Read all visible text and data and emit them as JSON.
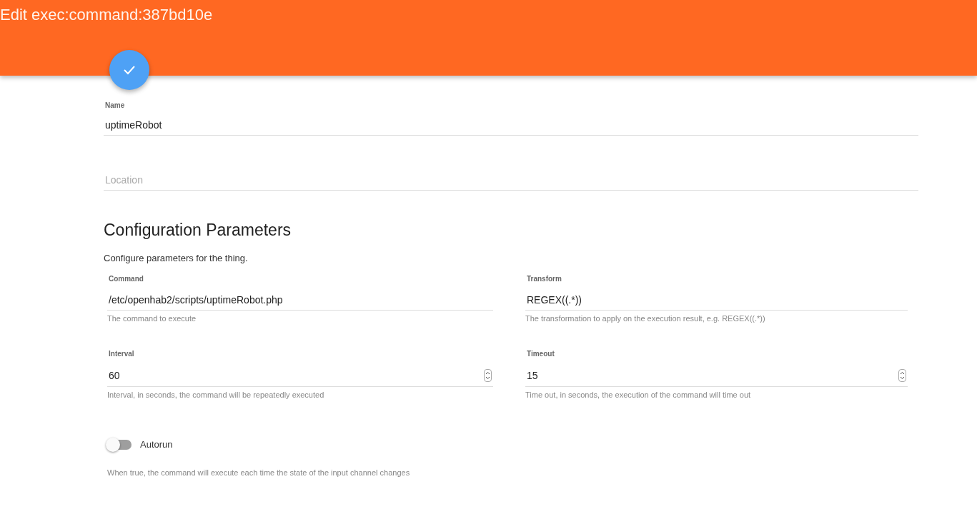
{
  "header": {
    "title": "Edit exec:command:387bd10e"
  },
  "fields": [
    {
      "label": "Name",
      "value": "uptimeRobot"
    },
    {
      "placeholder": "Location"
    }
  ],
  "config": {
    "title": "Configuration Parameters",
    "description": "Configure parameters for the thing.",
    "params": [
      {
        "kind": "text",
        "label": "Command",
        "value": "/etc/openhab2/scripts/uptimeRobot.php",
        "hint": "The command to execute"
      },
      {
        "kind": "text",
        "label": "Transform",
        "value": "REGEX((.*))",
        "hint": "The transformation to apply on the execution result, e.g. REGEX((.*))"
      },
      {
        "kind": "number",
        "label": "Interval",
        "value": "60",
        "hint": "Interval, in seconds, the command will be repeatedly executed"
      },
      {
        "kind": "number",
        "label": "Timeout",
        "value": "15",
        "hint": "Time out, in seconds, the execution of the command will time out"
      }
    ],
    "toggles": [
      {
        "label": "Autorun",
        "on": false,
        "hint": "When true, the command will execute each time the state of the input channel changes"
      }
    ]
  }
}
